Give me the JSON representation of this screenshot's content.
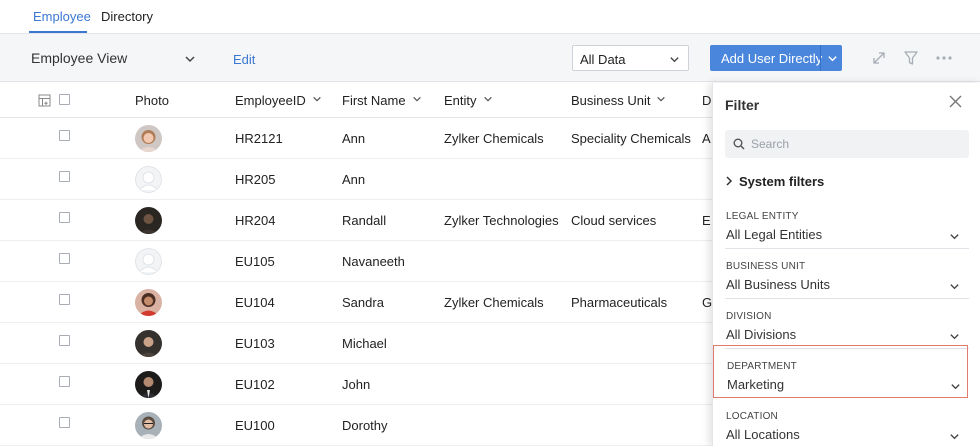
{
  "tabs": [
    {
      "label": "Employee"
    },
    {
      "label": "Directory"
    }
  ],
  "toolbar": {
    "view_title": "Employee View",
    "edit_label": "Edit",
    "data_select": "All Data",
    "add_button": "Add User Directly"
  },
  "table": {
    "columns": [
      "Photo",
      "EmployeeID",
      "First Name",
      "Entity",
      "Business Unit",
      "D"
    ],
    "rows": [
      {
        "id": "HR2121",
        "first": "Ann",
        "entity": "Zylker Chemicals",
        "unit": "Speciality Chemicals",
        "d": "A",
        "avatar": "woman-photo"
      },
      {
        "id": "HR205",
        "first": "Ann",
        "entity": "",
        "unit": "",
        "d": "",
        "avatar": "placeholder"
      },
      {
        "id": "HR204",
        "first": "Randall",
        "entity": "Zylker Technologies",
        "unit": "Cloud services",
        "d": "E",
        "avatar": "man-dark-photo"
      },
      {
        "id": "EU105",
        "first": "Navaneeth",
        "entity": "",
        "unit": "",
        "d": "",
        "avatar": "placeholder"
      },
      {
        "id": "EU104",
        "first": "Sandra",
        "entity": "Zylker Chemicals",
        "unit": "Pharmaceuticals",
        "d": "G",
        "avatar": "woman-red-photo"
      },
      {
        "id": "EU103",
        "first": "Michael",
        "entity": "",
        "unit": "",
        "d": "",
        "avatar": "man-photo"
      },
      {
        "id": "EU102",
        "first": "John",
        "entity": "",
        "unit": "",
        "d": "",
        "avatar": "man-suit-photo"
      },
      {
        "id": "EU100",
        "first": "Dorothy",
        "entity": "",
        "unit": "",
        "d": "",
        "avatar": "woman-glasses-photo"
      }
    ]
  },
  "filter": {
    "title": "Filter",
    "search_placeholder": "Search",
    "system_filters": "System filters",
    "groups": [
      {
        "label": "LEGAL ENTITY",
        "value": "All Legal Entities"
      },
      {
        "label": "BUSINESS UNIT",
        "value": "All Business Units"
      },
      {
        "label": "DIVISION",
        "value": "All Divisions"
      },
      {
        "label": "DEPARTMENT",
        "value": "Marketing"
      },
      {
        "label": "LOCATION",
        "value": "All Locations"
      }
    ]
  },
  "colors": {
    "accent": "#3a78d4",
    "button": "#4a86dc",
    "highlight": "#e07a6e"
  }
}
